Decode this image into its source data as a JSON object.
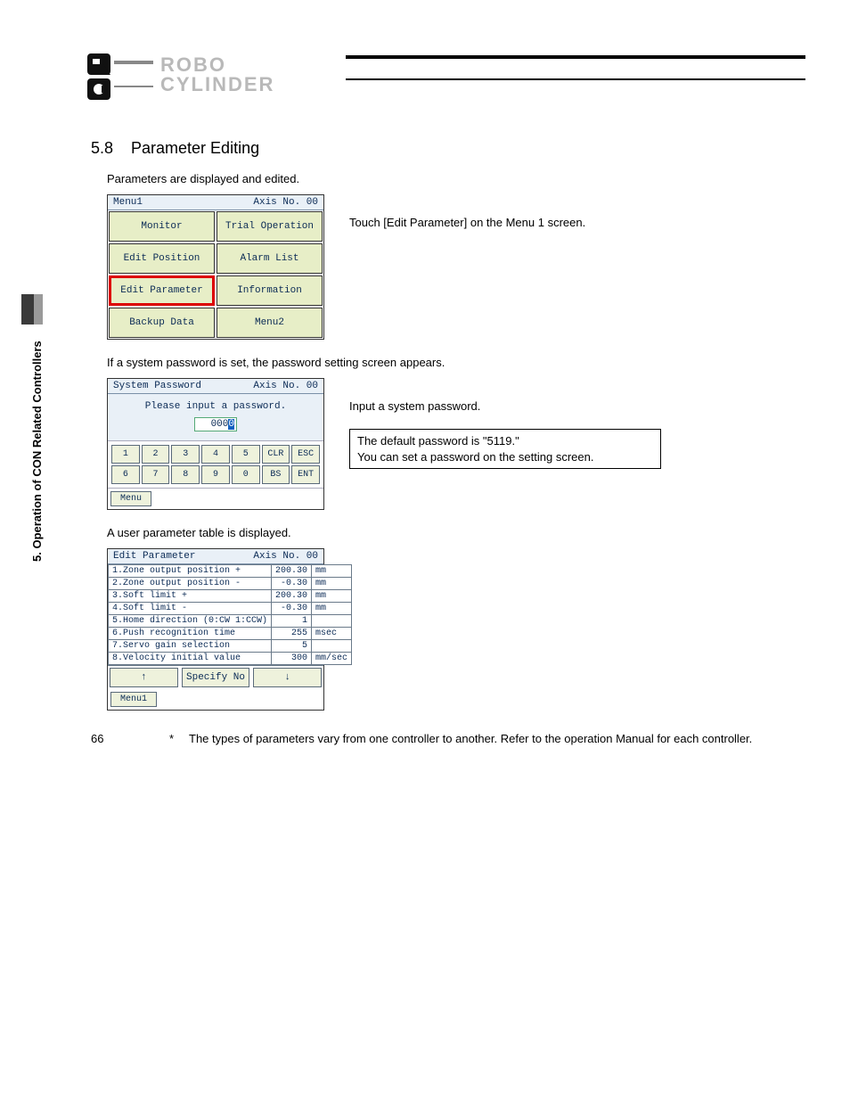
{
  "logo": {
    "line1": "ROBO",
    "line2": "CYLINDER"
  },
  "side_tab": "5. Operation of CON Related Controllers",
  "section": {
    "number": "5.8",
    "title": "Parameter Editing"
  },
  "intro": "Parameters are displayed and edited.",
  "menu1": {
    "title": "Menu1",
    "axis": "Axis No. 00",
    "cells": [
      "Monitor",
      "Trial Operation",
      "Edit Position",
      "Alarm List",
      "Edit Parameter",
      "Information",
      "Backup Data",
      "Menu2"
    ],
    "highlight_index": 4,
    "caption": "Touch [Edit Parameter] on the Menu 1 screen."
  },
  "pw_intro": "If a system password is set, the password setting screen appears.",
  "pw_panel": {
    "title": "System Password",
    "axis": "Axis No. 00",
    "msg": "Please input a password.",
    "value_prefix": "000",
    "value_cursor": "0",
    "keys_row1": [
      "1",
      "2",
      "3",
      "4",
      "5",
      "CLR",
      "ESC"
    ],
    "keys_row2": [
      "6",
      "7",
      "8",
      "9",
      "0",
      "BS",
      "ENT"
    ],
    "menu_btn": "Menu",
    "caption": "Input a system password.",
    "note_l1": "The default password is \"5119.\"",
    "note_l2": "You can set a password on the setting screen."
  },
  "table_intro": "A user parameter table is displayed.",
  "param_panel": {
    "title": "Edit Parameter",
    "axis": "Axis No. 00",
    "rows": [
      {
        "label": "1.Zone output position +",
        "val": "200.30",
        "unit": "mm"
      },
      {
        "label": "2.Zone output position -",
        "val": "-0.30",
        "unit": "mm"
      },
      {
        "label": "3.Soft limit +",
        "val": "200.30",
        "unit": "mm"
      },
      {
        "label": "4.Soft limit -",
        "val": "-0.30",
        "unit": "mm"
      },
      {
        "label": "5.Home direction (0:CW 1:CCW)",
        "val": "1",
        "unit": ""
      },
      {
        "label": "6.Push recognition time",
        "val": "255",
        "unit": "msec"
      },
      {
        "label": "7.Servo gain selection",
        "val": "5",
        "unit": ""
      },
      {
        "label": "8.Velocity initial value",
        "val": "300",
        "unit": "mm/sec"
      }
    ],
    "nav": {
      "up": "↑",
      "specify": "Specify No",
      "down": "↓"
    },
    "menu_btn": "Menu1"
  },
  "footnote": "The types of parameters vary from one controller to another. Refer to the operation Manual for each controller.",
  "page_number": "66"
}
